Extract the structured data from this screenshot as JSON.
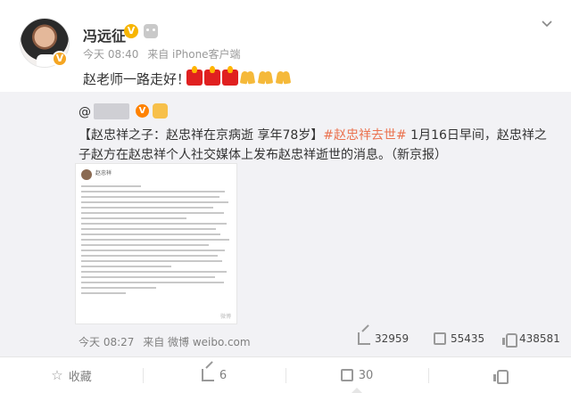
{
  "post": {
    "user_name": "冯远征",
    "time": "今天 08:40",
    "source": "来自 iPhone客户端",
    "text": "赵老师一路走好！"
  },
  "retweet": {
    "user_prefix": "@",
    "user_suffix": "...",
    "body_title": "【赵忠祥之子：赵忠祥在京病逝 享年78岁】",
    "hashtag": "#赵忠祥去世#",
    "body_rest": " 1月16日早间，赵忠祥之子赵方在赵忠祥个人社交媒体上发布赵忠祥逝世的消息。（新京报）",
    "thumb_name": "赵忠祥",
    "thumb_watermark": "微博",
    "time": "今天 08:27",
    "source": "来自 微博 weibo.com",
    "stats": {
      "share": "32959",
      "comment": "55435",
      "like": "438581"
    }
  },
  "actions": {
    "favorite": "收藏",
    "repost": "6",
    "comment": "30",
    "like": ""
  }
}
